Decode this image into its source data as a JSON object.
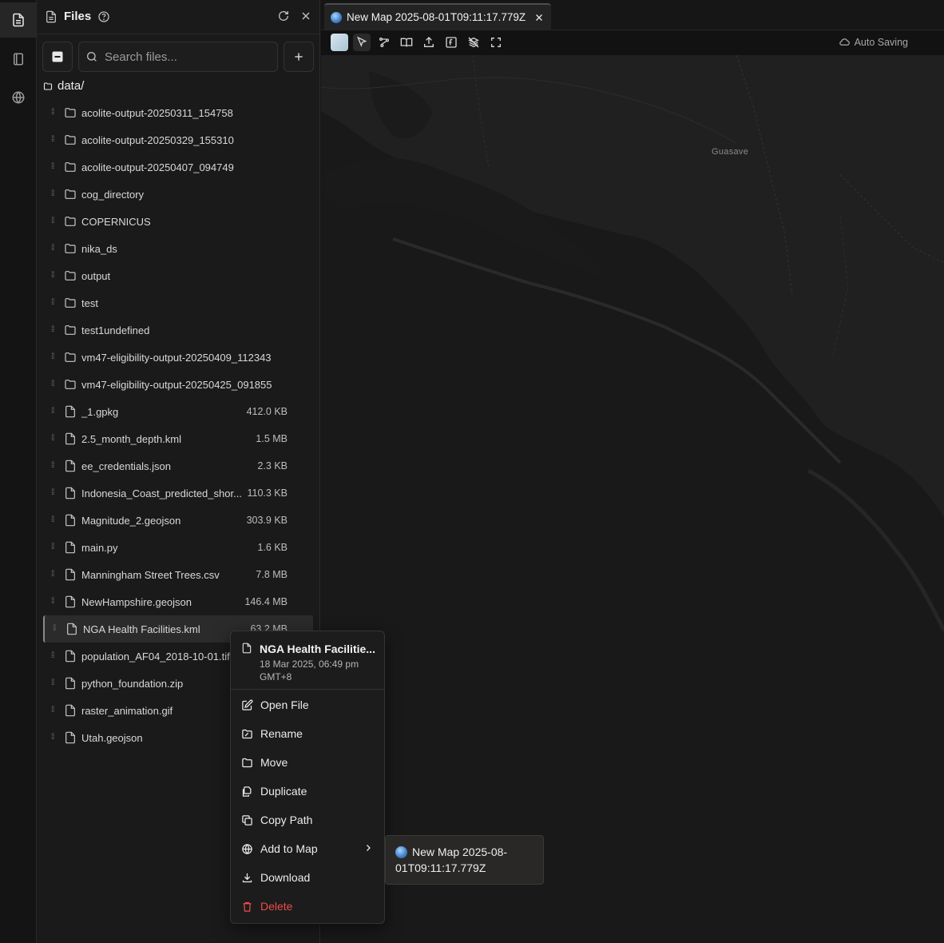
{
  "rail": {
    "items": [
      "files-icon",
      "notebook-icon",
      "globe-icon"
    ]
  },
  "files_panel": {
    "title": "Files",
    "search_placeholder": "Search files...",
    "root_folder": "data/",
    "items": [
      {
        "name": "acolite-output-20250311_154758",
        "type": "folder",
        "size": ""
      },
      {
        "name": "acolite-output-20250329_155310",
        "type": "folder",
        "size": ""
      },
      {
        "name": "acolite-output-20250407_094749",
        "type": "folder",
        "size": ""
      },
      {
        "name": "cog_directory",
        "type": "folder",
        "size": ""
      },
      {
        "name": "COPERNICUS",
        "type": "folder",
        "size": ""
      },
      {
        "name": "nika_ds",
        "type": "folder",
        "size": ""
      },
      {
        "name": "output",
        "type": "folder",
        "size": ""
      },
      {
        "name": "test",
        "type": "folder",
        "size": ""
      },
      {
        "name": "test1undefined",
        "type": "folder",
        "size": ""
      },
      {
        "name": "vm47-eligibility-output-20250409_112343",
        "type": "folder",
        "size": ""
      },
      {
        "name": "vm47-eligibility-output-20250425_091855",
        "type": "folder",
        "size": ""
      },
      {
        "name": "_1.gpkg",
        "type": "file",
        "size": "412.0 KB"
      },
      {
        "name": "2.5_month_depth.kml",
        "type": "file",
        "size": "1.5 MB"
      },
      {
        "name": "ee_credentials.json",
        "type": "file",
        "size": "2.3 KB"
      },
      {
        "name": "Indonesia_Coast_predicted_shor...",
        "type": "file",
        "size": "110.3 KB"
      },
      {
        "name": "Magnitude_2.geojson",
        "type": "file",
        "size": "303.9 KB"
      },
      {
        "name": "main.py",
        "type": "file",
        "size": "1.6 KB"
      },
      {
        "name": "Manningham Street Trees.csv",
        "type": "file",
        "size": "7.8 MB"
      },
      {
        "name": "NewHampshire.geojson",
        "type": "file",
        "size": "146.4 MB"
      },
      {
        "name": "NGA Health Facilities.kml",
        "type": "file",
        "size": "63.2 MB",
        "selected": true
      },
      {
        "name": "population_AF04_2018-10-01.tif",
        "type": "file",
        "size": ""
      },
      {
        "name": "python_foundation.zip",
        "type": "file",
        "size": ""
      },
      {
        "name": "raster_animation.gif",
        "type": "file",
        "size": ""
      },
      {
        "name": "Utah.geojson",
        "type": "file",
        "size": ""
      }
    ]
  },
  "map_tab": {
    "title": "New Map 2025-08-01T09:11:17.779Z"
  },
  "map_toolbar": {
    "autosave": "Auto Saving"
  },
  "map": {
    "place_label": "Guasave"
  },
  "context_menu": {
    "title": "NGA Health Facilitie...",
    "date": "18 Mar 2025, 06:49 pm",
    "timezone": "GMT+8",
    "items": {
      "open": "Open File",
      "rename": "Rename",
      "move": "Move",
      "duplicate": "Duplicate",
      "copy_path": "Copy Path",
      "add_to_map": "Add to Map",
      "download": "Download",
      "delete": "Delete"
    }
  },
  "submenu": {
    "map_line1": "New Map 2025-08-",
    "map_line2": "01T09:11:17.779Z"
  },
  "colors": {
    "danger": "#ef4b4b",
    "background": "#151515",
    "panel": "#1a1a1a"
  }
}
